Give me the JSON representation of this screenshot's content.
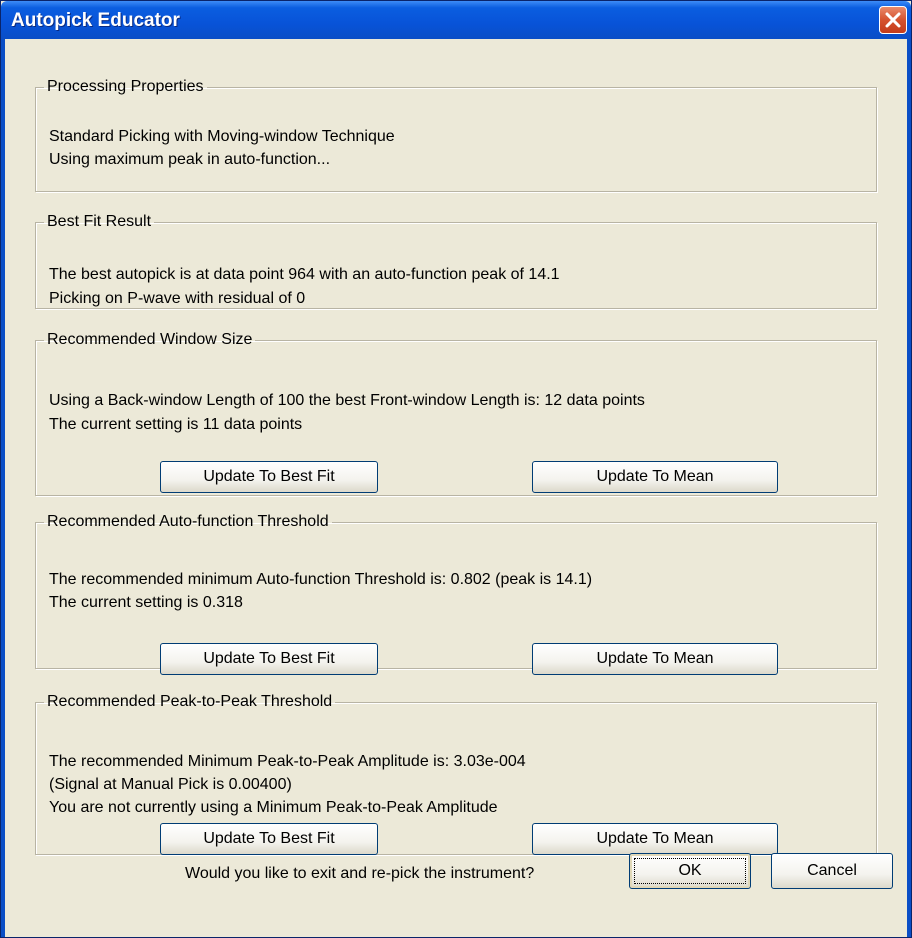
{
  "window": {
    "title": "Autopick Educator",
    "close_icon": "close-icon"
  },
  "processing": {
    "legend": "Processing Properties",
    "line1": "Standard Picking with Moving-window Technique",
    "line2": "Using maximum peak in auto-function..."
  },
  "best_fit": {
    "legend": "Best Fit Result",
    "line1": "The best autopick is at data point 964 with an auto-function peak of  14.1",
    "line2": "Picking on P-wave with residual of 0"
  },
  "window_size": {
    "legend": "Recommended Window Size",
    "line1": "Using a Back-window Length of 100 the best Front-window Length is: 12 data points",
    "line2": "The current setting is 11 data points",
    "best_fit_button": "Update To Best Fit",
    "mean_button": "Update To Mean"
  },
  "auto_threshold": {
    "legend": "Recommended Auto-function Threshold",
    "line1": "The recommended minimum Auto-function Threshold is: 0.802 (peak is  14.1)",
    "line2": "The current setting is 0.318",
    "best_fit_button": "Update To Best Fit",
    "mean_button": "Update To Mean"
  },
  "p2p_threshold": {
    "legend": "Recommended Peak-to-Peak Threshold",
    "line1": "The recommended Minimum Peak-to-Peak Amplitude is:  3.03e-004",
    "line2": "(Signal at Manual Pick is 0.00400)",
    "line3": "You are not currently using a Minimum Peak-to-Peak Amplitude",
    "best_fit_button": "Update To Best Fit",
    "mean_button": "Update To Mean"
  },
  "footer": {
    "question": "Would you like to exit and re-pick the instrument?",
    "ok": "OK",
    "cancel": "Cancel"
  },
  "colors": {
    "titlebar": "#0853d8",
    "dialog_bg": "#ece9d8",
    "close_button": "#d5522f"
  }
}
